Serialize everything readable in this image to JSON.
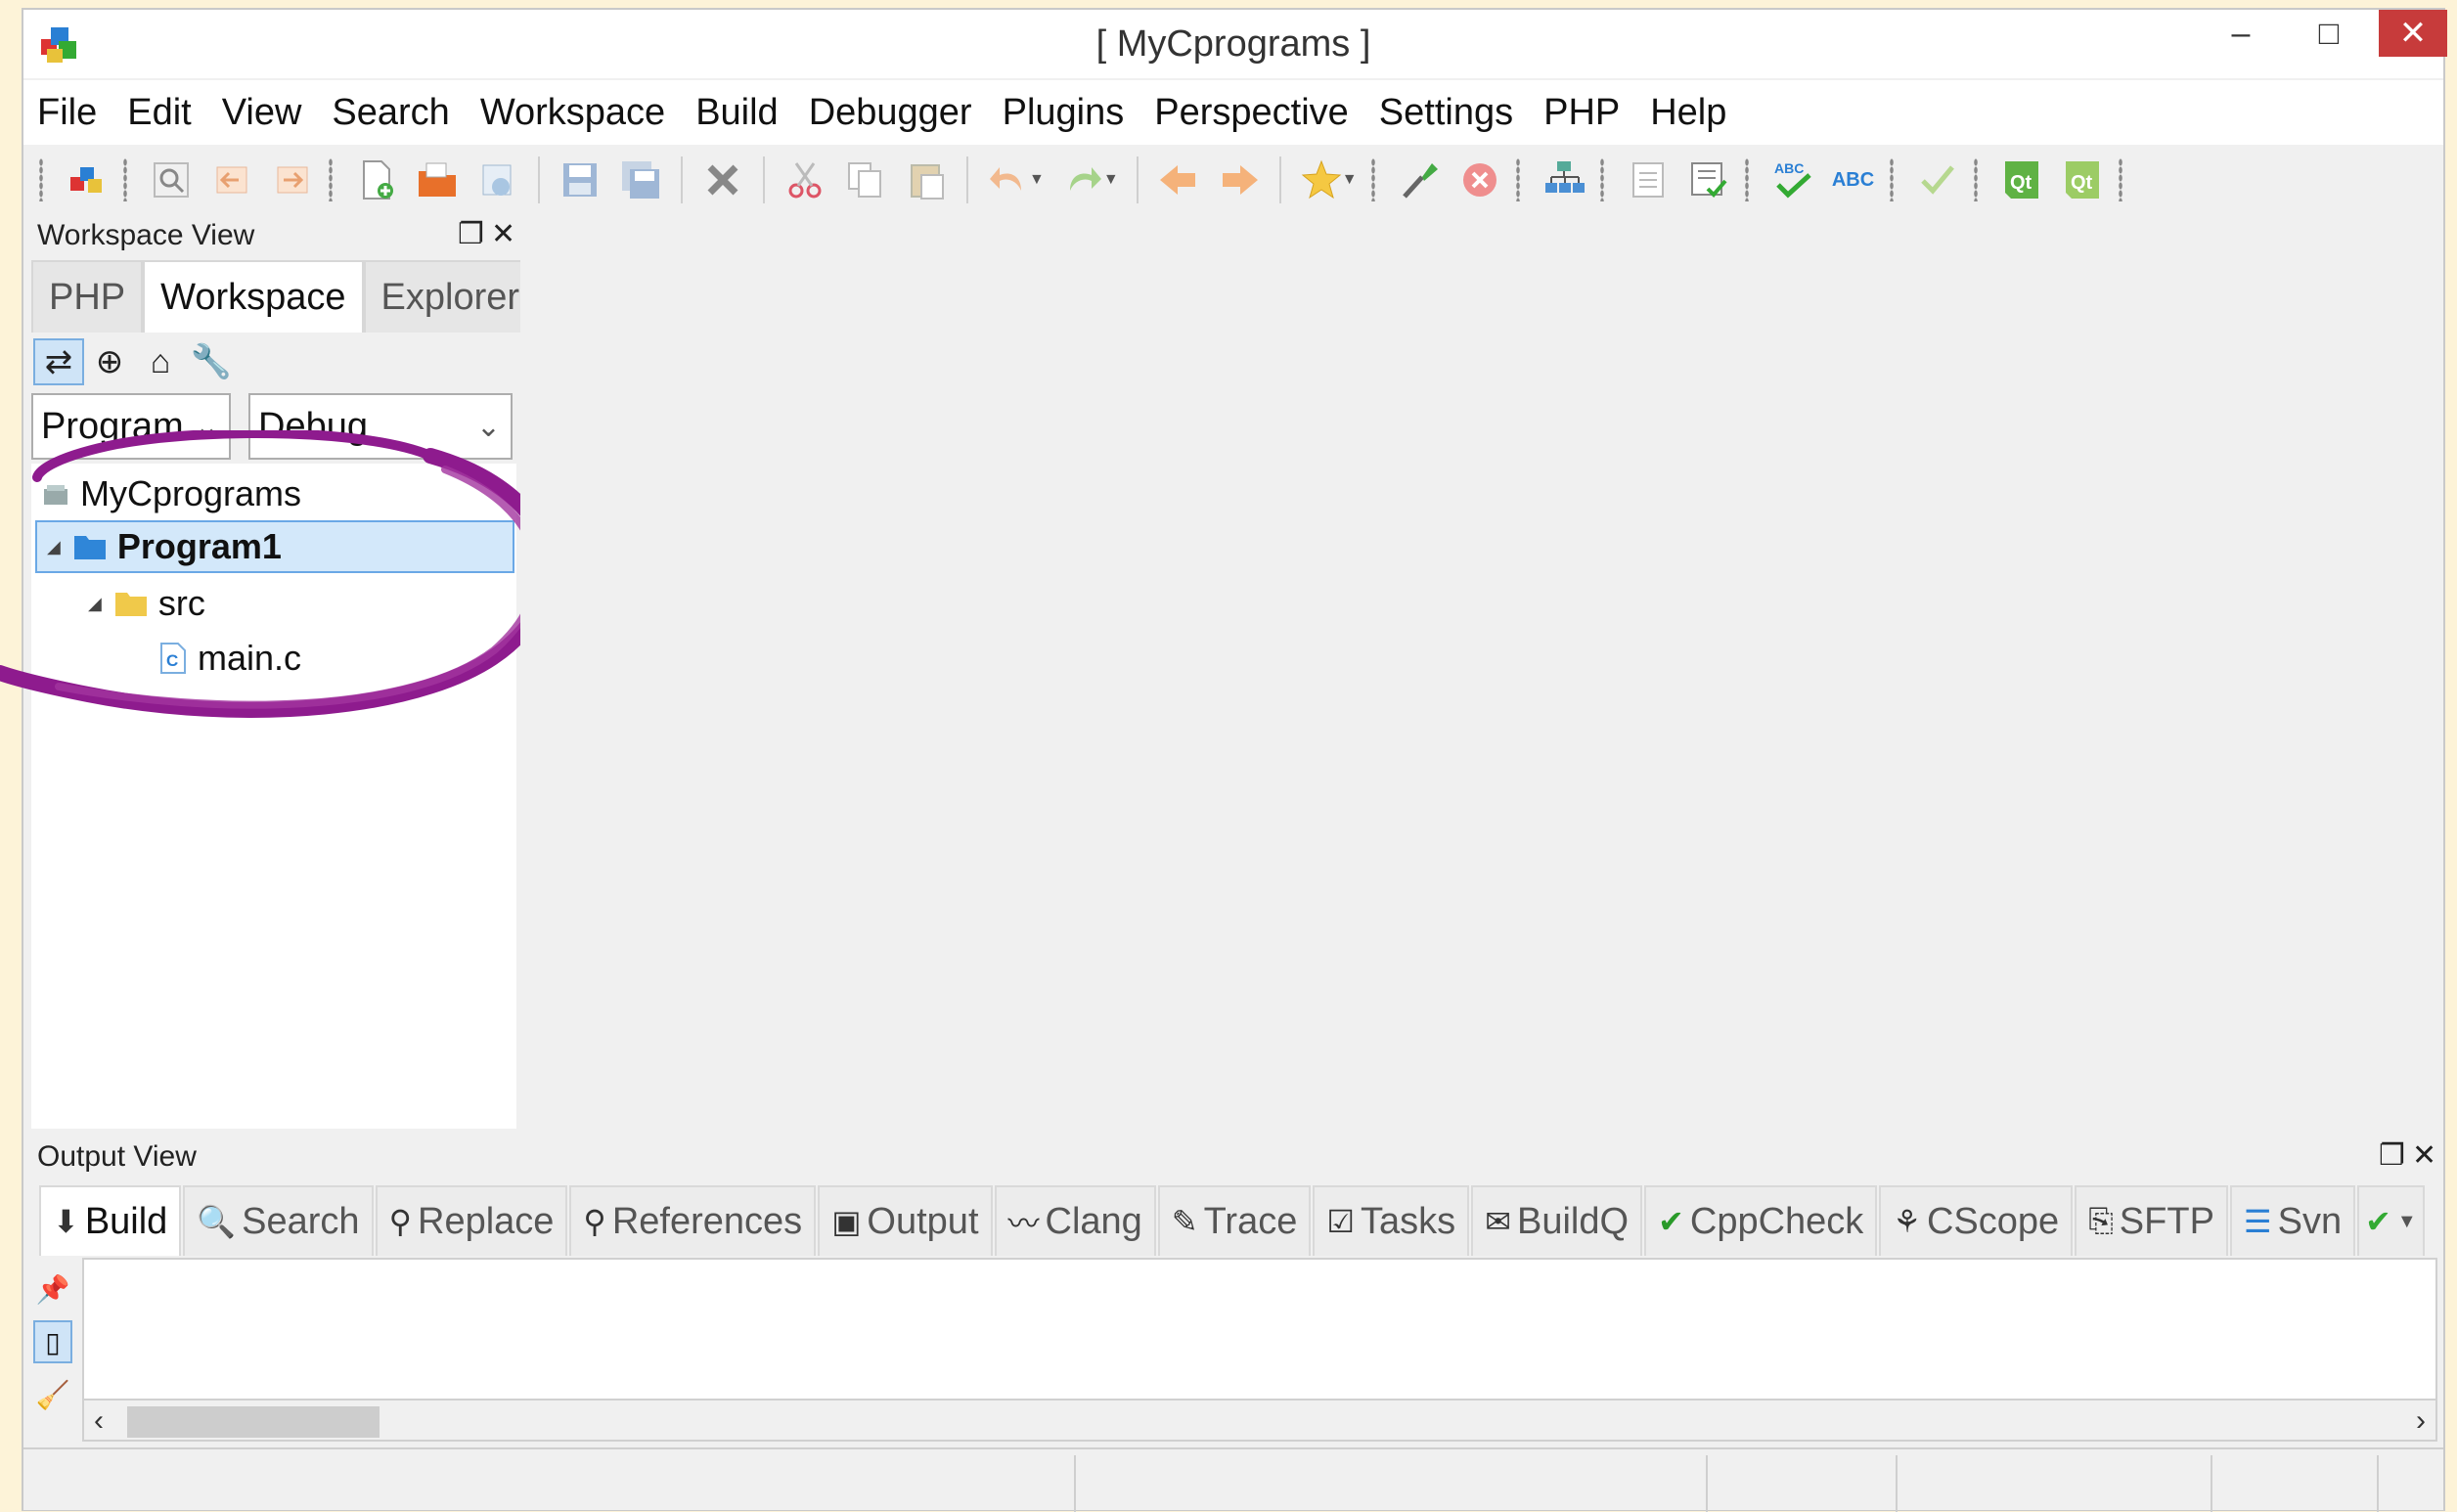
{
  "window": {
    "title": "[ MyCprograms ]"
  },
  "window_controls": {
    "minimize": "–",
    "maximize": "□",
    "close": "✕"
  },
  "menu": {
    "items": [
      "File",
      "Edit",
      "View",
      "Search",
      "Workspace",
      "Build",
      "Debugger",
      "Plugins",
      "Perspective",
      "Settings",
      "PHP",
      "Help"
    ]
  },
  "toolbar": {
    "icons": [
      "workspace-icon",
      "find-icon",
      "back-icon",
      "forward-icon",
      "new-file-icon",
      "open-folder-icon",
      "reload-icon",
      "save-icon",
      "save-all-icon",
      "close-file-icon",
      "cut-icon",
      "copy-icon",
      "paste-icon",
      "undo-icon",
      "redo-icon",
      "prev-icon",
      "next-icon",
      "bookmark-icon",
      "build-icon",
      "stop-icon",
      "class-diagram-icon",
      "list-icon",
      "checklist-icon",
      "spellcheck-icon",
      "abc-icon",
      "check-icon",
      "qt-icon",
      "qt-designer-icon"
    ],
    "spell_label": "ABC"
  },
  "workspace_view": {
    "title": "Workspace View",
    "tabs": [
      "PHP",
      "Workspace",
      "Explorer"
    ],
    "active_tab": "Workspace",
    "project_select": "Program",
    "config_select": "Debug",
    "tree": {
      "workspace": "MyCprograms",
      "project": "Program1",
      "folder": "src",
      "file": "main.c",
      "file_icon_letter": "C"
    }
  },
  "output_view": {
    "title": "Output View",
    "tabs": [
      {
        "label": "Build",
        "icon": "build-icon"
      },
      {
        "label": "Search",
        "icon": "search-icon"
      },
      {
        "label": "Replace",
        "icon": "replace-icon"
      },
      {
        "label": "References",
        "icon": "references-icon"
      },
      {
        "label": "Output",
        "icon": "terminal-icon"
      },
      {
        "label": "Clang",
        "icon": "clang-icon"
      },
      {
        "label": "Trace",
        "icon": "trace-icon"
      },
      {
        "label": "Tasks",
        "icon": "tasks-icon"
      },
      {
        "label": "BuildQ",
        "icon": "buildq-icon"
      },
      {
        "label": "CppCheck",
        "icon": "cppcheck-icon"
      },
      {
        "label": "CScope",
        "icon": "cscope-icon"
      },
      {
        "label": "SFTP",
        "icon": "sftp-icon"
      },
      {
        "label": "Svn",
        "icon": "svn-icon"
      }
    ],
    "active_tab": "Build"
  },
  "colors": {
    "annotation": "#8e1b8e",
    "close_button": "#c73b3b",
    "selection": "#d3e8fa"
  }
}
